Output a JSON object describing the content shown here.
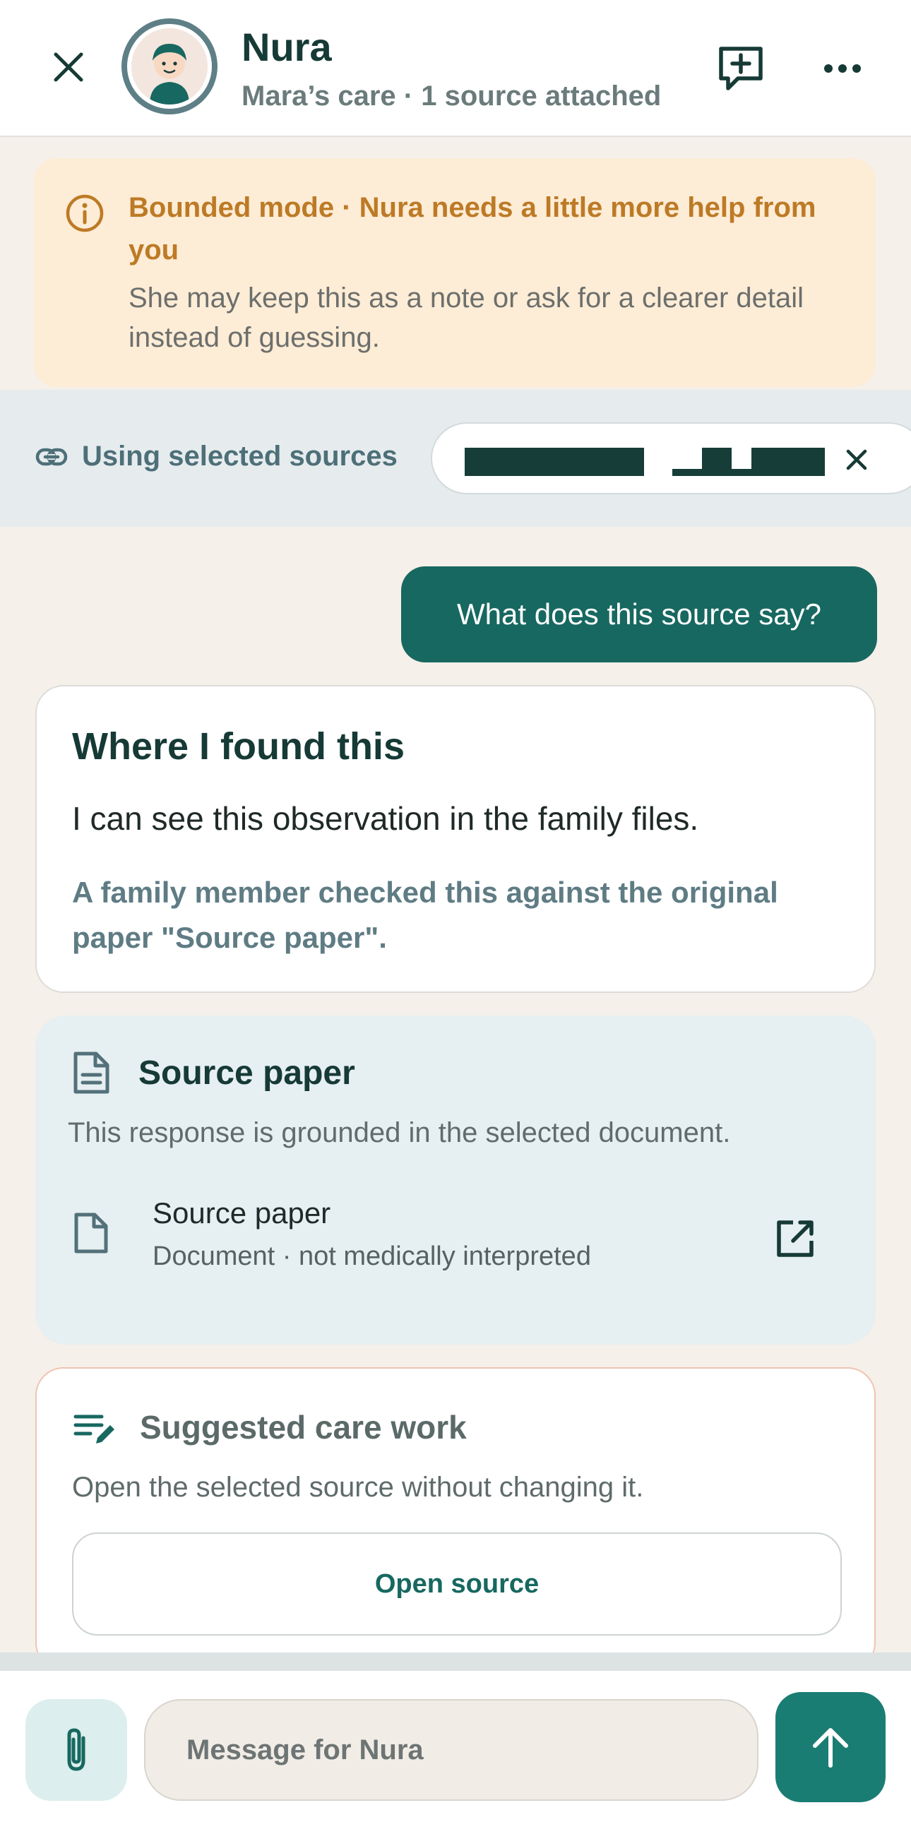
{
  "header": {
    "title": "Nura",
    "subtitle": "Mara’s care · 1 source attached",
    "icons": [
      "close-icon",
      "new-note-icon",
      "more-icon"
    ]
  },
  "banner": {
    "title": "Bounded mode · Nura needs a little more help from you",
    "body": "She may keep this as a note or ask for a clearer detail instead of guessing.",
    "icon": "info-icon"
  },
  "sources": {
    "label": "Using selected sources",
    "chip_text": "█████████ ▁▆▁▆██",
    "icon": "link-icon"
  },
  "conversation": {
    "user_message": "What does this source say?",
    "found": {
      "title": "Where I found this",
      "body": "I can see this observation in the family files.",
      "note": "A family member checked this against the original paper \"Source paper\"."
    },
    "source_panel": {
      "title": "Source paper",
      "description": "This response is grounded in the selected document.",
      "doc_name": "Source paper",
      "doc_meta": "Document · not medically interpreted"
    },
    "suggested": {
      "title": "Suggested care work",
      "description": "Open the selected source without changing it.",
      "button_label": "Open source"
    }
  },
  "composer": {
    "placeholder": "Message for Nura"
  },
  "colors": {
    "accent": "#176860",
    "banner_bg": "#fdecd6",
    "banner_text": "#bd7a25",
    "source_bg": "#e6eff1",
    "page_bg": "#f5f0e9"
  }
}
